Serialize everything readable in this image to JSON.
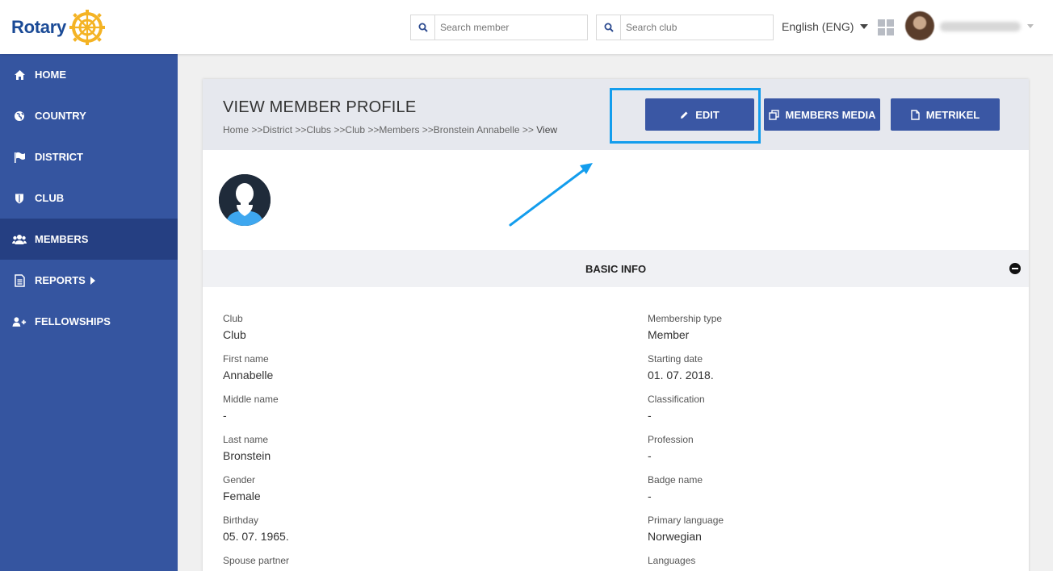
{
  "brand": {
    "name": "Rotary",
    "accent": "#3555a0",
    "highlight": "#139ded"
  },
  "header": {
    "search_member_placeholder": "Search member",
    "search_club_placeholder": "Search club",
    "language": "English (ENG)"
  },
  "sidebar": {
    "items": [
      {
        "label": "HOME",
        "icon": "home-icon"
      },
      {
        "label": "COUNTRY",
        "icon": "globe-icon"
      },
      {
        "label": "DISTRICT",
        "icon": "flag-icon"
      },
      {
        "label": "CLUB",
        "icon": "shield-icon"
      },
      {
        "label": "MEMBERS",
        "icon": "users-icon",
        "active": true
      },
      {
        "label": "REPORTS",
        "icon": "document-icon",
        "has_submenu": true
      },
      {
        "label": "FELLOWSHIPS",
        "icon": "user-add-icon"
      }
    ]
  },
  "page": {
    "title": "VIEW MEMBER PROFILE",
    "breadcrumb": "Home >>District >>Clubs >>Club >>Members >>Bronstein Annabelle >>",
    "breadcrumb_current": "View",
    "buttons": {
      "edit": "EDIT",
      "media": "MEMBERS MEDIA",
      "metrikel": "METRIKEL"
    }
  },
  "basic_info": {
    "title": "BASIC INFO",
    "left": [
      {
        "label": "Club",
        "value": "Club"
      },
      {
        "label": "First name",
        "value": "Annabelle"
      },
      {
        "label": "Middle name",
        "value": "-"
      },
      {
        "label": "Last name",
        "value": "Bronstein"
      },
      {
        "label": "Gender",
        "value": "Female"
      },
      {
        "label": "Birthday",
        "value": "05. 07. 1965."
      },
      {
        "label": "Spouse partner",
        "value": ""
      }
    ],
    "right": [
      {
        "label": "Membership type",
        "value": "Member"
      },
      {
        "label": "Starting date",
        "value": "01. 07. 2018."
      },
      {
        "label": "Classification",
        "value": "-"
      },
      {
        "label": "Profession",
        "value": "-"
      },
      {
        "label": "Badge name",
        "value": "-"
      },
      {
        "label": "Primary language",
        "value": "Norwegian"
      },
      {
        "label": "Languages",
        "value": ""
      }
    ]
  }
}
